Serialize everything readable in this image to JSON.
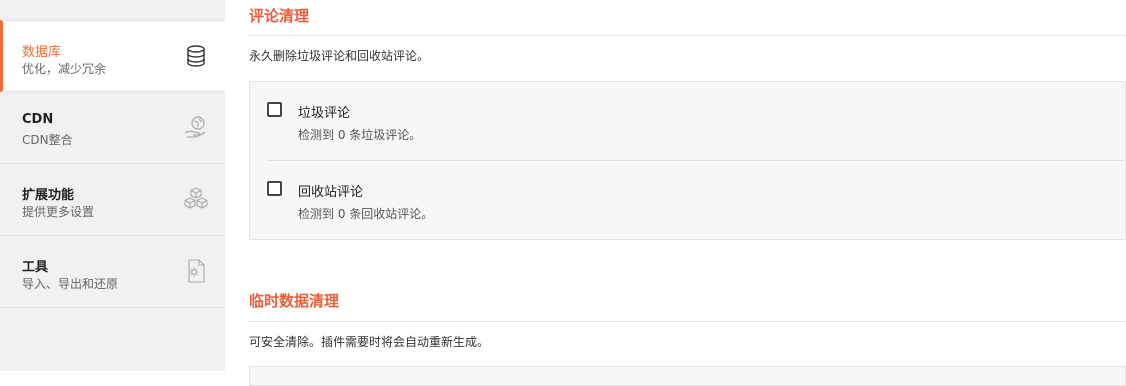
{
  "sidebar": {
    "items": [
      {
        "title": "数据库",
        "subtitle": "优化，减少冗余",
        "icon": "database-icon",
        "active": true
      },
      {
        "title": "CDN",
        "subtitle": "CDN整合",
        "icon": "globe-hand-icon",
        "active": false
      },
      {
        "title": "扩展功能",
        "subtitle": "提供更多设置",
        "icon": "cubes-icon",
        "active": false
      },
      {
        "title": "工具",
        "subtitle": "导入、导出和还原",
        "icon": "gear-document-icon",
        "active": false
      }
    ]
  },
  "sections": {
    "comments": {
      "title": "评论清理",
      "description": "永久删除垃圾评论和回收站评论。",
      "options": [
        {
          "label": "垃圾评论",
          "hint": "检测到 0 条垃圾评论。",
          "checked": false
        },
        {
          "label": "回收站评论",
          "hint": "检测到 0 条回收站评论。",
          "checked": false
        }
      ]
    },
    "transients": {
      "title": "临时数据清理",
      "description": "可安全清除。插件需要时将会自动重新生成。"
    }
  },
  "colors": {
    "accent": "#f06e33",
    "heading": "#e8603c",
    "sidebar_bg": "#f1f1f1"
  }
}
